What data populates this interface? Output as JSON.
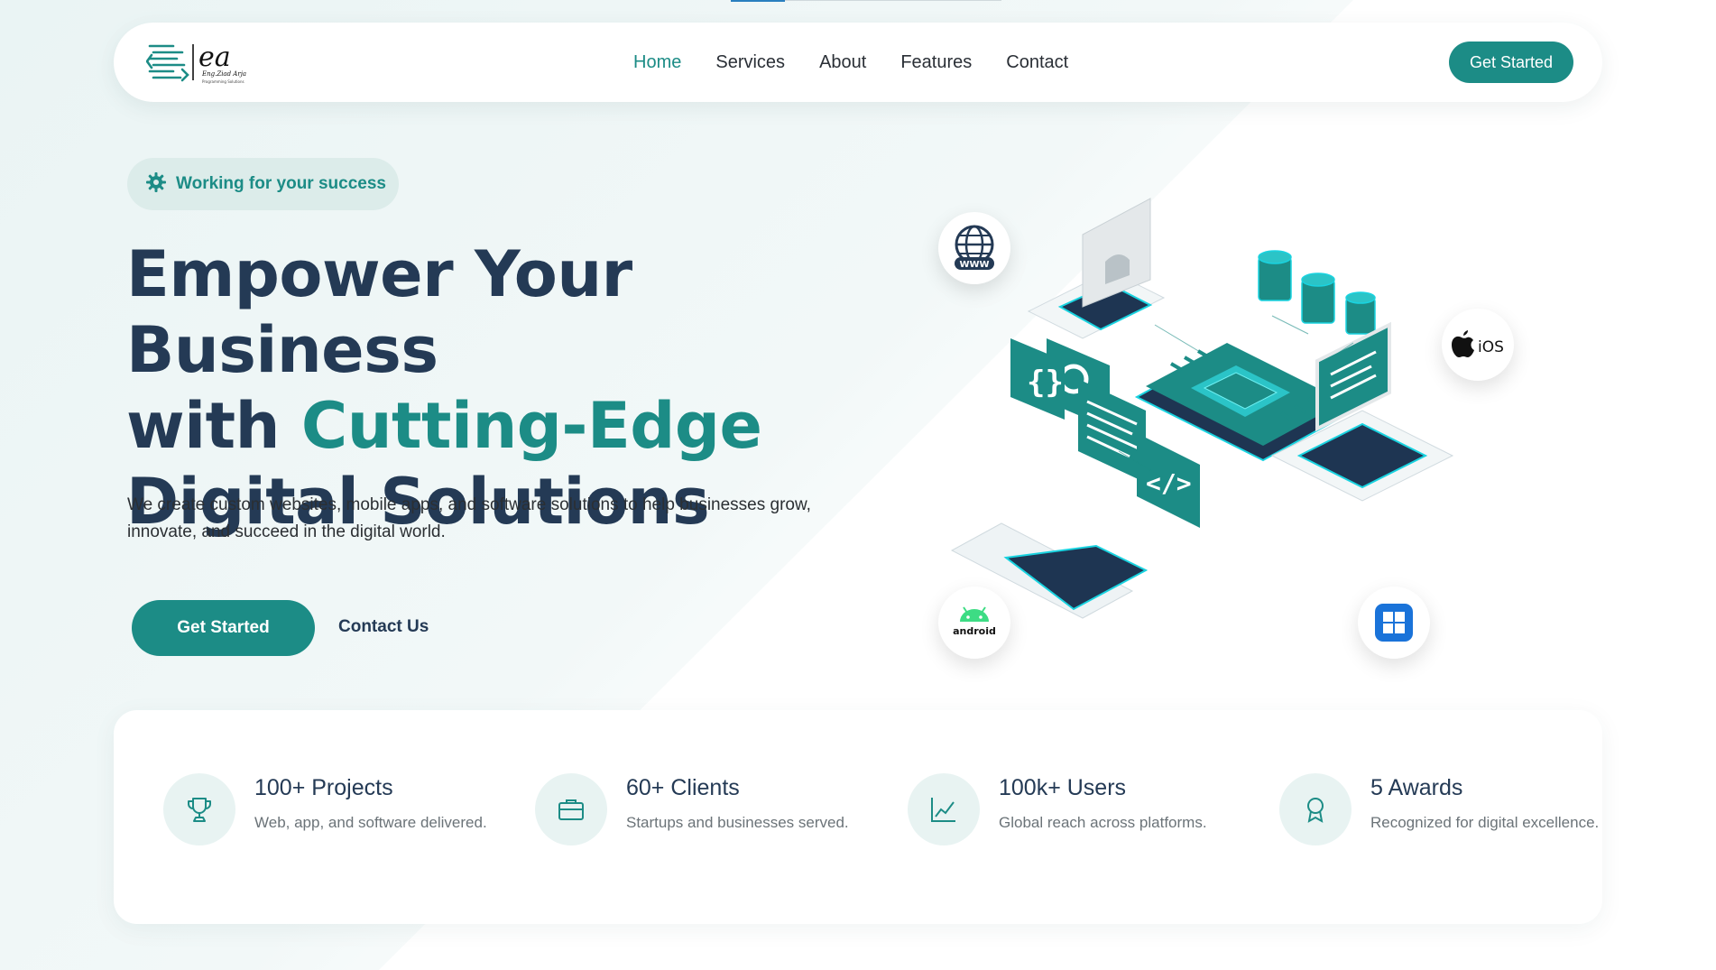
{
  "colors": {
    "accent": "#1c8c86",
    "heading": "#243a55",
    "badge_bg": "#dcecea"
  },
  "brand": {
    "logo_text": "ea",
    "logo_sub": "Eng.Ziad Arja",
    "logo_tag": "Programming Solutions"
  },
  "nav": {
    "links": [
      {
        "label": "Home",
        "active": true
      },
      {
        "label": "Services",
        "active": false
      },
      {
        "label": "About",
        "active": false
      },
      {
        "label": "Features",
        "active": false
      },
      {
        "label": "Contact",
        "active": false
      }
    ],
    "cta": "Get Started"
  },
  "hero": {
    "badge": "Working for your success",
    "title_line1": "Empower Your Business",
    "title_with": "with ",
    "title_accent": "Cutting-Edge",
    "title_line3": "Digital Solutions",
    "description": "We create custom websites, mobile apps, and software solutions to help businesses grow, innovate, and succeed in the digital world.",
    "primary_button": "Get Started",
    "secondary_button": "Contact Us"
  },
  "platforms": {
    "web": "WWW",
    "ios": "iOS",
    "android": "android",
    "windows_icon": "windows-icon"
  },
  "stats": [
    {
      "icon": "trophy-icon",
      "title": "100+ Projects",
      "desc": "Web, app, and software delivered."
    },
    {
      "icon": "briefcase-icon",
      "title": "60+ Clients",
      "desc": "Startups and businesses served."
    },
    {
      "icon": "chart-line-icon",
      "title": "100k+ Users",
      "desc": "Global reach across platforms."
    },
    {
      "icon": "award-icon",
      "title": "5 Awards",
      "desc": "Recognized for digital excellence."
    }
  ]
}
